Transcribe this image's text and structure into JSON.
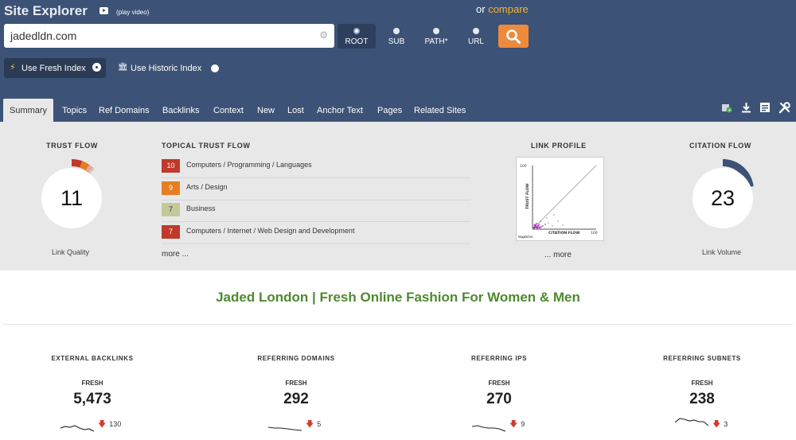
{
  "header": {
    "title": "Site Explorer",
    "play_video": "(play video)",
    "or_text": "or",
    "compare": "compare"
  },
  "search": {
    "value": "jadedldn.com"
  },
  "scopes": [
    {
      "label": "ROOT",
      "selected": true
    },
    {
      "label": "SUB",
      "selected": false
    },
    {
      "label": "PATH*",
      "selected": false
    },
    {
      "label": "URL",
      "selected": false
    }
  ],
  "index": {
    "fresh": "Use Fresh Index",
    "historic": "Use Historic Index"
  },
  "tabs": [
    "Summary",
    "Topics",
    "Ref Domains",
    "Backlinks",
    "Context",
    "New",
    "Lost",
    "Anchor Text",
    "Pages",
    "Related Sites"
  ],
  "trust_flow": {
    "title": "TRUST FLOW",
    "value": "11",
    "caption": "Link Quality"
  },
  "topical": {
    "title": "TOPICAL TRUST FLOW",
    "items": [
      {
        "score": "10",
        "label": "Computers / Programming / Languages",
        "color": "#c0392b"
      },
      {
        "score": "9",
        "label": "Arts / Design",
        "color": "#e67e22"
      },
      {
        "score": "7",
        "label": "Business",
        "color": "#c5c89a"
      },
      {
        "score": "7",
        "label": "Computers / Internet / Web Design and Development",
        "color": "#c0392b"
      }
    ],
    "more": "more ..."
  },
  "link_profile": {
    "title": "LINK PROFILE",
    "y_label": "TRUST FLOW",
    "x_label": "CITATION FLOW",
    "x_max": "100",
    "y_max": "100",
    "y_min": "0",
    "logo": "MAJESTIC",
    "more": "... more"
  },
  "citation_flow": {
    "title": "CITATION FLOW",
    "value": "23",
    "caption": "Link Volume",
    "fraction": 0.23
  },
  "site_title": "Jaded London | Fresh Online Fashion For Women & Men",
  "stats": [
    {
      "title": "EXTERNAL BACKLINKS",
      "sub": "FRESH",
      "value": "5,473",
      "delta": "130"
    },
    {
      "title": "REFERRING DOMAINS",
      "sub": "FRESH",
      "value": "292",
      "delta": "5"
    },
    {
      "title": "REFERRING IPS",
      "sub": "FRESH",
      "value": "270",
      "delta": "9"
    },
    {
      "title": "REFERRING SUBNETS",
      "sub": "FRESH",
      "value": "238",
      "delta": "3"
    }
  ],
  "colors": {
    "header": "#3c5276",
    "accent": "#ed8a3c",
    "compare": "#f2b233",
    "title_green": "#4f8a2e",
    "down": "#d43b2c"
  }
}
